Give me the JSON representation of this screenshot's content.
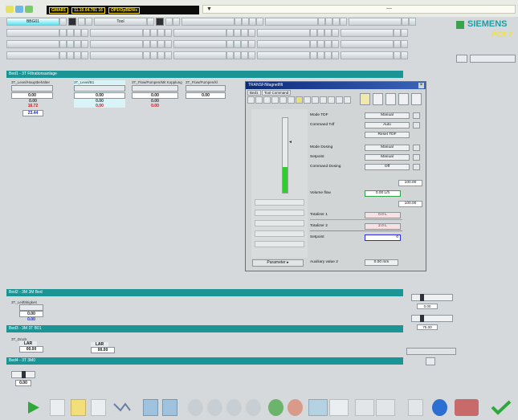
{
  "header": {
    "status_cells": [
      "GMAR1",
      "11.10.04.781 16",
      "OP1\\OpBEN/s"
    ],
    "message_marker": "▼",
    "message_dash": "—"
  },
  "nav": {
    "tab1_label": "BBG01",
    "tab2_label": "Tool"
  },
  "brand": {
    "siemens": "SIEMENS",
    "pcs7": "PCS 7"
  },
  "sections": {
    "top": "Bed1 - 3T Filtrationsanlage",
    "middle1": "Bed2 - 3M 3M Bed",
    "middle2": "Bed3 - 3M 3T B01",
    "middle3": "Bed4 - 3T 3M0"
  },
  "faceplates": [
    {
      "title": "3T_Level/Hauptbehälter",
      "value": "0.00",
      "sub": "0.00",
      "red": "16.72",
      "blue": "23.44"
    },
    {
      "title": "3T_Level/B1",
      "value": "0.00",
      "sub": "0.00",
      "red": "0.00"
    },
    {
      "title": "3T_Flow/Pumpen/Mit Kopplung",
      "value": "0.00",
      "sub": "0.00",
      "red": "0.00"
    },
    {
      "title": "3T_Flow/Pumpen/kl",
      "value": "0.00"
    }
  ],
  "dialog": {
    "title": "TRANSF/Magnetfilt",
    "tab1": "Bed1",
    "tab2": "Tool Command",
    "rows": {
      "mode_tdf": "Mode TDF",
      "mode_tdf_val": "Manual",
      "command_tdf": "Command Tdf",
      "command_tdf_val": "Auto",
      "reset_tdf": "Reset TDF",
      "mode_dosing": "Mode Dosing",
      "mode_dosing_val": "Manual",
      "setpoint": "Setpoint",
      "setpoint_val": "Manual",
      "command_dosing": "Command Dosing",
      "command_dosing_val": "Off",
      "field_a": "100.00",
      "volume_flow": "Volume flow",
      "volume_flow_val": "0.00 L/h",
      "field_b": "100.00",
      "totalizer1": "Totalizer 1",
      "totalizer1_val": "0.0 L",
      "totalizer2": "Totalizer 2",
      "totalizer2_val": "2.0 L",
      "setpoint2": "Setpoint",
      "setpoint2_val": "0",
      "auxiliary": "Auxiliary value 2",
      "auxiliary_val": "0.00 mm"
    },
    "parameter_btn": "Parameter ▸",
    "bar_fill_pct": 34
  },
  "lower": {
    "box_a_title": "3T_Leitfähigkeit",
    "box_a_val": "0.00",
    "box_a_sub": "0.00",
    "box_b_title": "3T_Druck",
    "box_b_val": "0.00",
    "box_c_val": "0.00",
    "right1_val": "0.00",
    "right2_val": "75.00",
    "lower_label1": "LAR",
    "lower_label2": "LAR",
    "lower_val1": "00.00",
    "lower_val2": "00.00"
  },
  "colors": {
    "section": "#1b9496",
    "accent": "#5de2ee",
    "bar": "#2fcf2c"
  },
  "toolbar_icons": [
    "play-icon",
    "page-icon",
    "folder-icon",
    "copy-icon",
    "scale-icon",
    "screen-icon",
    "screen2-icon",
    "left-icon",
    "up-icon",
    "down-icon",
    "right-icon",
    "refresh-icon",
    "refresh2-icon",
    "shortcut-icon",
    "route-icon",
    "route2-icon",
    "route3-icon",
    "plant-icon",
    "help-icon",
    "speaker-icon",
    "check-icon"
  ]
}
